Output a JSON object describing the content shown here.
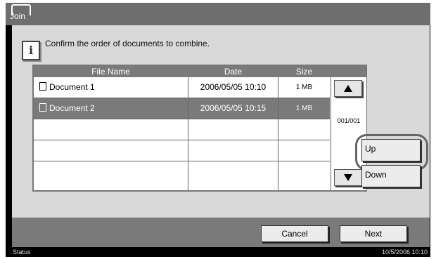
{
  "window": {
    "title": "Join"
  },
  "info": {
    "message": "Confirm the order of documents to combine.",
    "icon_glyph": "i"
  },
  "table": {
    "columns": [
      "File Name",
      "Date",
      "Size"
    ],
    "rows": [
      {
        "name": "Document 1",
        "date": "2006/05/05 10:10",
        "size": "1 MB",
        "selected": false
      },
      {
        "name": "Document 2",
        "date": "2006/05/05 10:15",
        "size": "1 MB",
        "selected": true
      },
      {
        "name": "",
        "date": "",
        "size": ""
      },
      {
        "name": "",
        "date": "",
        "size": ""
      },
      {
        "name": "",
        "date": "",
        "size": ""
      }
    ],
    "page_indicator": "001/001"
  },
  "side_buttons": {
    "up_label": "Up",
    "down_label": "Down"
  },
  "footer": {
    "cancel_label": "Cancel",
    "next_label": "Next"
  },
  "status": {
    "label": "Status",
    "datetime": "10/5/2006   10:10"
  },
  "colors": {
    "header": "#7a7a7a",
    "panel": "#d9d9d9",
    "selected_row": "#7a7a7a"
  }
}
